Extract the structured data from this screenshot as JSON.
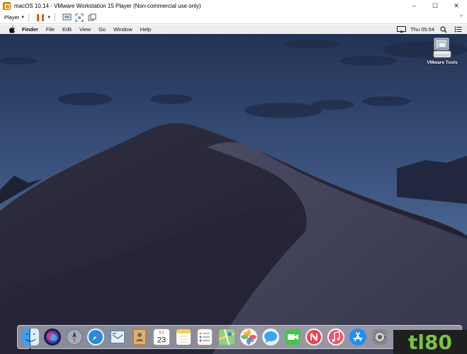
{
  "window": {
    "title": "macOS 10.14 - VMware Workstation 15 Player (Non-commercial use only)",
    "controls": {
      "minimize": "–",
      "maximize": "☐",
      "close": "✕"
    }
  },
  "toolbar": {
    "player_label": "Player",
    "icons": [
      "pause-icon",
      "send-ctrl-alt-del-icon",
      "fit-window-icon",
      "unity-icon"
    ],
    "right_icon": "full-screen-icon"
  },
  "menubar": {
    "apple": "apple-icon",
    "app_name": "Finder",
    "items": [
      "File",
      "Edit",
      "View",
      "Go",
      "Window",
      "Help"
    ],
    "clock": "Thu 05:54"
  },
  "desktop": {
    "icons": [
      {
        "label": "VMware Tools",
        "icon": "vmware-tools-disk-icon"
      }
    ]
  },
  "dock": {
    "items": [
      {
        "name": "finder",
        "icon": "finder-icon",
        "color": "#2e8fe8",
        "running": true
      },
      {
        "name": "siri",
        "icon": "siri-icon",
        "color": "#2a2a6a"
      },
      {
        "name": "launchpad",
        "icon": "launchpad-icon",
        "color": "#5f6b7a"
      },
      {
        "name": "safari",
        "icon": "safari-icon",
        "color": "#1b8fe6"
      },
      {
        "name": "mail",
        "icon": "mail-icon",
        "color": "#6c5b3f"
      },
      {
        "name": "contacts",
        "icon": "contacts-icon",
        "color": "#a8783f"
      },
      {
        "name": "calendar",
        "icon": "calendar-icon",
        "color": "#ffffff",
        "month": "JUL",
        "day": "23"
      },
      {
        "name": "notes",
        "icon": "notes-icon",
        "color": "#f7d84a"
      },
      {
        "name": "reminders",
        "icon": "reminders-icon",
        "color": "#f4f4f4"
      },
      {
        "name": "maps",
        "icon": "maps-icon",
        "color": "#7cc36c"
      },
      {
        "name": "photos",
        "icon": "photos-icon",
        "color": "#ffffff"
      },
      {
        "name": "messages",
        "icon": "messages-icon",
        "color": "#3aa4f5"
      },
      {
        "name": "facetime",
        "icon": "facetime-icon",
        "color": "#3ec94a"
      },
      {
        "name": "news",
        "icon": "news-icon",
        "color": "#f2f2f2"
      },
      {
        "name": "music",
        "icon": "music-icon",
        "color": "#fb3a5b"
      },
      {
        "name": "app-store",
        "icon": "app-store-icon",
        "color": "#1b8ef7"
      },
      {
        "name": "system-preferences",
        "icon": "system-preferences-icon",
        "color": "#7a7a7a"
      }
    ]
  },
  "watermark": {
    "text": "tl80",
    "icon": "tl80-logo"
  },
  "colors": {
    "sky_top": "#24355a",
    "sky_bottom": "#5d7ba6",
    "dune": "#2a2838",
    "accent_orange": "#e05a1d",
    "logo_green": "#7dc242"
  }
}
